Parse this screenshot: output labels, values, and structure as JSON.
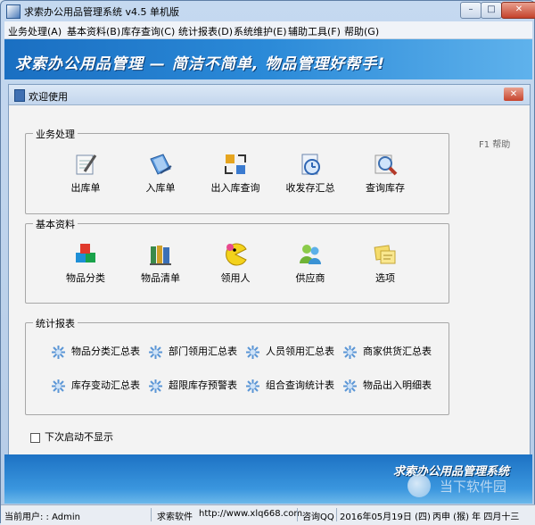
{
  "window": {
    "title": "求索办公用品管理系统 v4.5 单机版",
    "min_label": "–",
    "max_label": "□",
    "close_label": "✕"
  },
  "menu": [
    "业务处理(A)",
    "基本资料(B)",
    "库存查询(C)",
    "统计报表(D)",
    "系统维护(E)",
    "辅助工具(F)",
    "帮助(G)"
  ],
  "banner": {
    "text": "求索办公用品管理 — 简洁不简单, 物品管理好帮手!"
  },
  "child_window": {
    "title": "欢迎使用",
    "close_label": "✕",
    "help": "F1 帮助"
  },
  "business": {
    "title": "业务处理",
    "items": [
      {
        "label": "出库单",
        "icon": "notepad-pencil-icon"
      },
      {
        "label": "入库单",
        "icon": "book-pencil-icon"
      },
      {
        "label": "出入库查询",
        "icon": "swap-arrows-icon"
      },
      {
        "label": "收发存汇总",
        "icon": "document-clock-icon"
      },
      {
        "label": "查询库存",
        "icon": "magnifier-icon"
      }
    ]
  },
  "basics": {
    "title": "基本资料",
    "items": [
      {
        "label": "物品分类",
        "icon": "colored-blocks-icon"
      },
      {
        "label": "物品清单",
        "icon": "books-icon"
      },
      {
        "label": "领用人",
        "icon": "pacman-face-icon"
      },
      {
        "label": "供应商",
        "icon": "people-icon"
      },
      {
        "label": "选项",
        "icon": "sticky-notes-icon"
      }
    ]
  },
  "reports": {
    "title": "统计报表",
    "items": [
      "物品分类汇总表",
      "部门领用汇总表",
      "人员领用汇总表",
      "商家供货汇总表",
      "库存变动汇总表",
      "超限库存预警表",
      "组合查询统计表",
      "物品出入明细表"
    ]
  },
  "startup_checkbox": "下次启动不显示",
  "bottom_banner": {
    "text": "求索办公用品管理系统",
    "watermark": "当下软件园"
  },
  "status_bar": {
    "user": "当前用户: : Admin",
    "company": "求索软件",
    "url": "http://www.xlq668.com",
    "consult": "咨询QQ",
    "date": "2016年05月19日 (四)",
    "lunar": "丙申 (猴) 年 四月十三"
  },
  "colors": {
    "banner": "#2b8ad8",
    "close_red": "#c4422b",
    "frame": "#b5cbe6"
  }
}
